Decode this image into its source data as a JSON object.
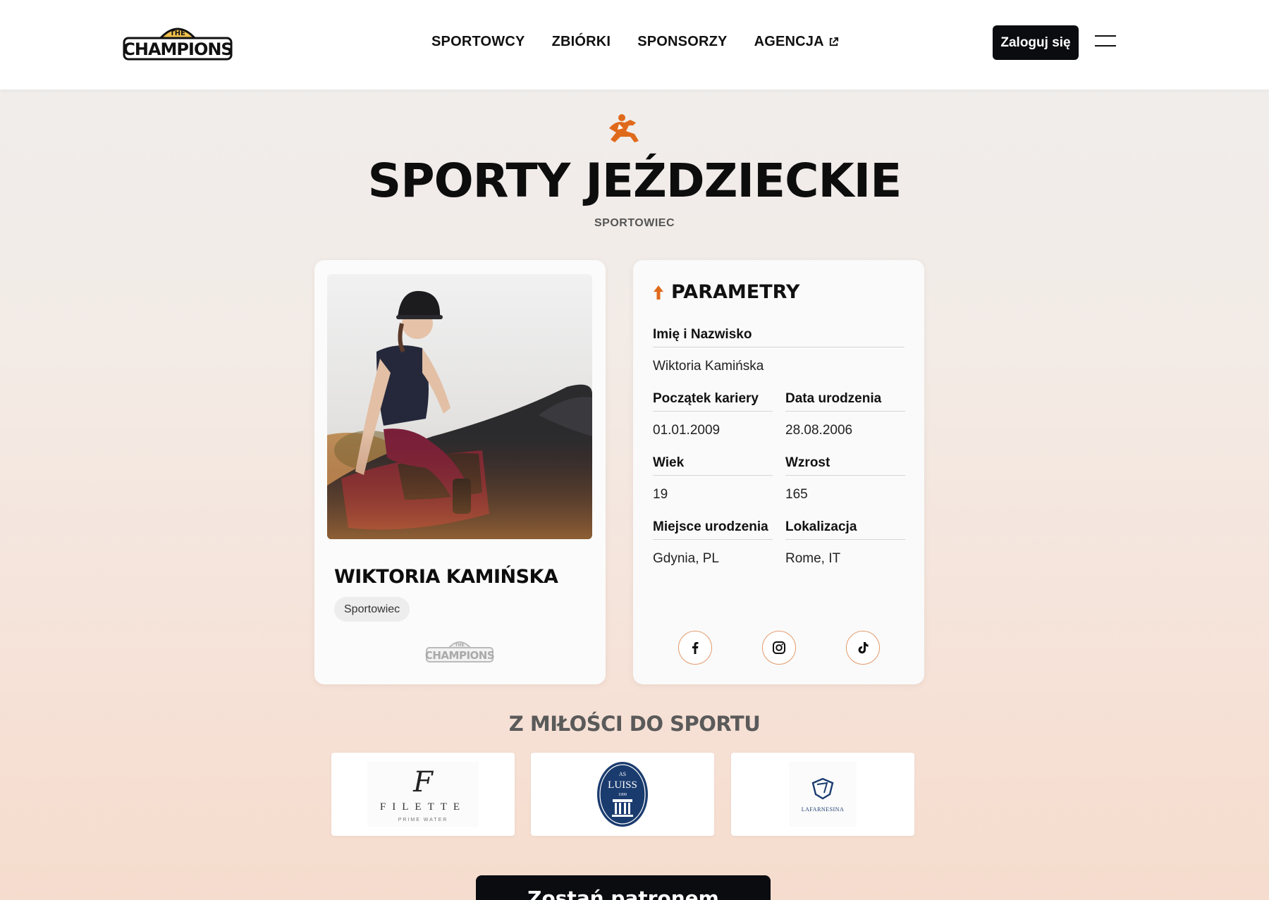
{
  "header": {
    "logo_text_top": "THE",
    "logo_text_main": "CHAMPIONS",
    "nav": [
      {
        "label": "SPORTOWCY"
      },
      {
        "label": "ZBIÓRKI"
      },
      {
        "label": "SPONSORZY"
      },
      {
        "label": "AGENCJA",
        "external": true
      }
    ],
    "login_label": "Zaloguj się"
  },
  "hero": {
    "icon": "horse-jumping-icon",
    "title": "SPORTY JEŹDZIECKIE",
    "subtitle": "SPORTOWIEC"
  },
  "profile": {
    "name": "WIKTORIA KAMIŃSKA",
    "role": "Sportowiec",
    "logo_text_top": "THE",
    "logo_text_main": "CHAMPIONS"
  },
  "params": {
    "title": "PARAMETRY",
    "fields": {
      "full_name": {
        "label": "Imię i Nazwisko",
        "value": "Wiktoria Kamińska"
      },
      "career_start": {
        "label": "Początek kariery",
        "value": "01.01.2009"
      },
      "birth_date": {
        "label": "Data urodzenia",
        "value": "28.08.2006"
      },
      "age": {
        "label": "Wiek",
        "value": "19"
      },
      "height": {
        "label": "Wzrost",
        "value": "165"
      },
      "birth_place": {
        "label": "Miejsce urodzenia",
        "value": "Gdynia, PL"
      },
      "location": {
        "label": "Lokalizacja",
        "value": "Rome, IT"
      }
    },
    "socials": [
      "facebook-icon",
      "instagram-icon",
      "tiktok-icon"
    ]
  },
  "sponsors": {
    "title": "Z MIŁOŚCI DO SPORTU",
    "items": [
      {
        "mark": "F",
        "name": "FILETTE",
        "tagline": "PRIME WATER"
      },
      {
        "mark": "AS",
        "name": "LUISS",
        "tagline": "1999"
      },
      {
        "name": "LAFARNESINA"
      }
    ]
  },
  "cta": {
    "label": "Zostań patronem"
  },
  "colors": {
    "accent": "#e06a1b",
    "dark": "#0b0c10",
    "logo_gold": "#f2c14e"
  }
}
